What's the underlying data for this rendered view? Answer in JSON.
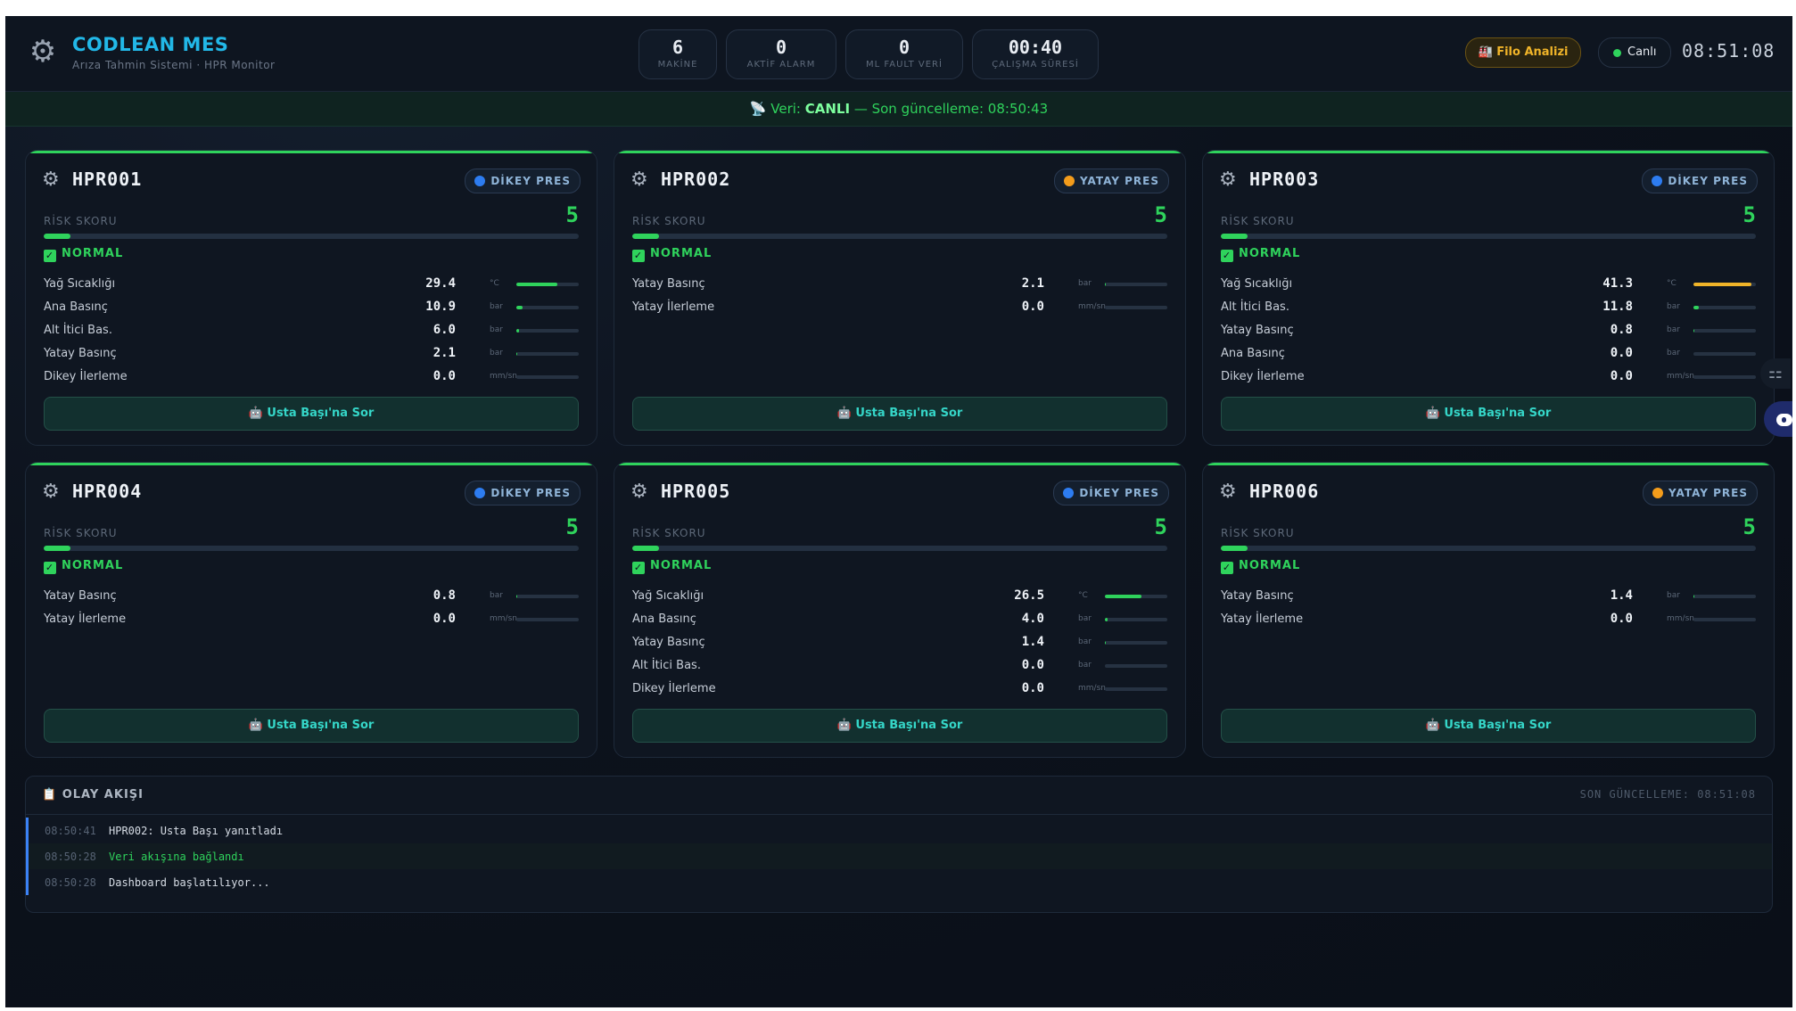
{
  "header": {
    "brand": "CODLEAN MES",
    "subtitle": "Arıza Tahmin Sistemi · HPR Monitor",
    "stats": [
      {
        "value": "6",
        "label": "MAKİNE"
      },
      {
        "value": "0",
        "label": "AKTİF ALARM"
      },
      {
        "value": "0",
        "label": "ML FAULT VERİ"
      },
      {
        "value": "00:40",
        "label": "ÇALIŞMA SÜRESİ"
      }
    ],
    "filo_button": "🏭 Filo Analizi",
    "live_label": "Canlı",
    "clock": "08:51:08"
  },
  "status_bar": {
    "prefix": "📡 Veri: ",
    "state": "CANLI",
    "suffix": " — Son güncelleme: 08:50:43"
  },
  "labels": {
    "risk": "RİSK SKORU",
    "ask_button": "🤖 Usta Başı'na Sor"
  },
  "machines": [
    {
      "id": "HPR001",
      "type": "DİKEY PRES",
      "type_color": "#2d7cf0",
      "risk": "5",
      "risk_pct": 5,
      "status": "NORMAL",
      "sensors": [
        {
          "label": "Yağ Sıcaklığı",
          "value": "29.4",
          "unit": "°C",
          "pct": 65,
          "color": "#2fd35c"
        },
        {
          "label": "Ana Basınç",
          "value": "10.9",
          "unit": "bar",
          "pct": 10,
          "color": "#2fd35c"
        },
        {
          "label": "Alt İtici Bas.",
          "value": "6.0",
          "unit": "bar",
          "pct": 4,
          "color": "#2fd35c"
        },
        {
          "label": "Yatay Basınç",
          "value": "2.1",
          "unit": "bar",
          "pct": 2,
          "color": "#2fd35c"
        },
        {
          "label": "Dikey İlerleme",
          "value": "0.0",
          "unit": "mm/sn",
          "pct": 0,
          "color": "#2fd35c"
        }
      ]
    },
    {
      "id": "HPR002",
      "type": "YATAY PRES",
      "type_color": "#f39c1b",
      "risk": "5",
      "risk_pct": 5,
      "status": "NORMAL",
      "sensors": [
        {
          "label": "Yatay Basınç",
          "value": "2.1",
          "unit": "bar",
          "pct": 2,
          "color": "#2fd35c"
        },
        {
          "label": "Yatay İlerleme",
          "value": "0.0",
          "unit": "mm/sn",
          "pct": 0,
          "color": "#2fd35c"
        }
      ]
    },
    {
      "id": "HPR003",
      "type": "DİKEY PRES",
      "type_color": "#2d7cf0",
      "risk": "5",
      "risk_pct": 5,
      "status": "NORMAL",
      "sensors": [
        {
          "label": "Yağ Sıcaklığı",
          "value": "41.3",
          "unit": "°C",
          "pct": 93,
          "color": "#f0b429"
        },
        {
          "label": "Alt İtici Bas.",
          "value": "11.8",
          "unit": "bar",
          "pct": 9,
          "color": "#2fd35c"
        },
        {
          "label": "Yatay Basınç",
          "value": "0.8",
          "unit": "bar",
          "pct": 1,
          "color": "#2fd35c"
        },
        {
          "label": "Ana Basınç",
          "value": "0.0",
          "unit": "bar",
          "pct": 0,
          "color": "#2fd35c"
        },
        {
          "label": "Dikey İlerleme",
          "value": "0.0",
          "unit": "mm/sn",
          "pct": 0,
          "color": "#2fd35c"
        }
      ]
    },
    {
      "id": "HPR004",
      "type": "DİKEY PRES",
      "type_color": "#2d7cf0",
      "risk": "5",
      "risk_pct": 5,
      "status": "NORMAL",
      "sensors": [
        {
          "label": "Yatay Basınç",
          "value": "0.8",
          "unit": "bar",
          "pct": 1,
          "color": "#2fd35c"
        },
        {
          "label": "Yatay İlerleme",
          "value": "0.0",
          "unit": "mm/sn",
          "pct": 0,
          "color": "#2fd35c"
        }
      ]
    },
    {
      "id": "HPR005",
      "type": "DİKEY PRES",
      "type_color": "#2d7cf0",
      "risk": "5",
      "risk_pct": 5,
      "status": "NORMAL",
      "sensors": [
        {
          "label": "Yağ Sıcaklığı",
          "value": "26.5",
          "unit": "°C",
          "pct": 58,
          "color": "#2fd35c"
        },
        {
          "label": "Ana Basınç",
          "value": "4.0",
          "unit": "bar",
          "pct": 4,
          "color": "#2fd35c"
        },
        {
          "label": "Yatay Basınç",
          "value": "1.4",
          "unit": "bar",
          "pct": 2,
          "color": "#2fd35c"
        },
        {
          "label": "Alt İtici Bas.",
          "value": "0.0",
          "unit": "bar",
          "pct": 0,
          "color": "#2fd35c"
        },
        {
          "label": "Dikey İlerleme",
          "value": "0.0",
          "unit": "mm/sn",
          "pct": 0,
          "color": "#2fd35c"
        }
      ]
    },
    {
      "id": "HPR006",
      "type": "YATAY PRES",
      "type_color": "#f39c1b",
      "risk": "5",
      "risk_pct": 5,
      "status": "NORMAL",
      "sensors": [
        {
          "label": "Yatay Basınç",
          "value": "1.4",
          "unit": "bar",
          "pct": 2,
          "color": "#2fd35c"
        },
        {
          "label": "Yatay İlerleme",
          "value": "0.0",
          "unit": "mm/sn",
          "pct": 0,
          "color": "#2fd35c"
        }
      ]
    }
  ],
  "events": {
    "title": "📋 OLAY AKIŞI",
    "last_update": "SON GÜNCELLEME: 08:51:08",
    "items": [
      {
        "time": "08:50:41",
        "message": "HPR002: Usta Başı yanıtladı",
        "color": "#d6dce5"
      },
      {
        "time": "08:50:28",
        "message": "Veri akışına bağlandı",
        "color": "#2fd35c"
      },
      {
        "time": "08:50:28",
        "message": "Dashboard başlatılıyor...",
        "color": "#d6dce5"
      }
    ]
  },
  "colors": {
    "accent": "#22b8e8",
    "ok": "#2fd35c",
    "warn": "#f0b429"
  }
}
